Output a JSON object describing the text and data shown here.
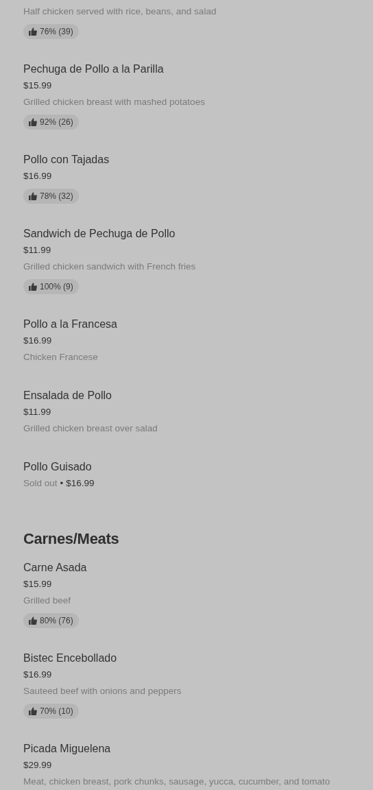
{
  "sections": [
    {
      "items": [
        {
          "description": "Half chicken served with rice, beans, and salad",
          "rating": "76% (39)"
        },
        {
          "name": "Pechuga de Pollo a la Parilla",
          "price": "$15.99",
          "description": "Grilled chicken breast with mashed potatoes",
          "rating": "92% (26)"
        },
        {
          "name": "Pollo con Tajadas",
          "price": "$16.99",
          "rating": "78% (32)"
        },
        {
          "name": "Sandwich de Pechuga de Pollo",
          "price": "$11.99",
          "description": "Grilled chicken sandwich with French fries",
          "rating": "100% (9)"
        },
        {
          "name": "Pollo a la Francesa",
          "price": "$16.99",
          "description": "Chicken Francese"
        },
        {
          "name": "Ensalada de Pollo",
          "price": "$11.99",
          "description": "Grilled chicken breast over salad"
        },
        {
          "name": "Pollo Guisado",
          "availability": "Sold out",
          "separator": "•",
          "price": "$16.99"
        }
      ]
    },
    {
      "title": "Carnes/Meats",
      "items": [
        {
          "name": "Carne Asada",
          "price": "$15.99",
          "description": "Grilled beef",
          "rating": "80% (76)"
        },
        {
          "name": "Bistec Encebollado",
          "price": "$16.99",
          "description": "Sauteed beef with onions and peppers",
          "rating": "70% (10)"
        },
        {
          "name": "Picada Miguelena",
          "price": "$29.99",
          "description": "Meat, chicken breast, pork chunks, sausage, yucca, cucumber, and tomato"
        }
      ]
    }
  ]
}
